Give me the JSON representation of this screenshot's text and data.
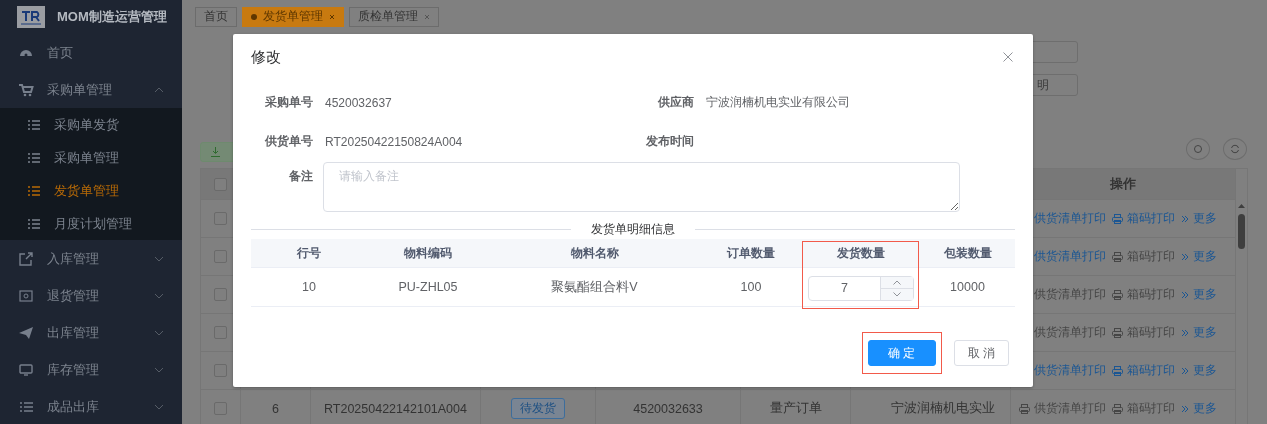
{
  "sidebar": {
    "title": "MOM制造运营管理",
    "items": [
      {
        "label": "首页"
      },
      {
        "label": "采购单管理",
        "expanded": true,
        "children": [
          {
            "label": "采购单发货",
            "selected": false
          },
          {
            "label": "采购单管理",
            "selected": false
          },
          {
            "label": "发货单管理",
            "selected": true
          },
          {
            "label": "月度计划管理",
            "selected": false
          }
        ]
      },
      {
        "label": "入库管理",
        "expanded": false
      },
      {
        "label": "退货管理",
        "expanded": false
      },
      {
        "label": "出库管理",
        "expanded": false
      },
      {
        "label": "库存管理",
        "expanded": false
      },
      {
        "label": "成品出库",
        "expanded": false
      }
    ]
  },
  "tabs": [
    {
      "label": "首页",
      "selected": false,
      "closable": false
    },
    {
      "label": "发货单管理",
      "selected": true,
      "closable": true
    },
    {
      "label": "质检单管理",
      "selected": false,
      "closable": true
    }
  ],
  "filter_field_placeholder": "明",
  "table": {
    "header_checked": false,
    "action_header": "操作",
    "rows": [
      {
        "checked": false,
        "actions": [
          {
            "label": "供货清单打印",
            "disabled": false
          },
          {
            "label": "箱码打印",
            "disabled": false
          },
          {
            "label": "更多",
            "disabled": false
          }
        ]
      },
      {
        "checked": false,
        "actions": [
          {
            "label": "供货清单打印",
            "disabled": false
          },
          {
            "label": "箱码打印",
            "disabled": true
          },
          {
            "label": "更多",
            "disabled": false
          }
        ]
      },
      {
        "checked": false,
        "actions": [
          {
            "label": "供货清单打印",
            "disabled": true
          },
          {
            "label": "箱码打印",
            "disabled": true
          },
          {
            "label": "更多",
            "disabled": false
          }
        ]
      },
      {
        "checked": false,
        "actions": [
          {
            "label": "供货清单打印",
            "disabled": true
          },
          {
            "label": "箱码打印",
            "disabled": true
          },
          {
            "label": "更多",
            "disabled": false
          }
        ]
      },
      {
        "checked": false,
        "actions": [
          {
            "label": "供货清单打印",
            "disabled": false
          },
          {
            "label": "箱码打印",
            "disabled": false
          },
          {
            "label": "更多",
            "disabled": false
          }
        ]
      },
      {
        "checked": false,
        "index": "6",
        "supply_no": "RT20250422142101A004",
        "status": "待发货",
        "purchase_no": "4520032633",
        "order_type": "量产订单",
        "supplier": "宁波润楠机电实业",
        "actions": [
          {
            "label": "供货清单打印",
            "disabled": true
          },
          {
            "label": "箱码打印",
            "disabled": true
          },
          {
            "label": "更多",
            "disabled": false
          }
        ]
      }
    ]
  },
  "dialog": {
    "title": "修改",
    "fields": [
      {
        "label": "采购单号",
        "value": "4520032637"
      },
      {
        "label": "供应商",
        "value": "宁波润楠机电实业有限公司"
      },
      {
        "label": "供货单号",
        "value": "RT20250422150824A004"
      },
      {
        "label": "发布时间"
      }
    ],
    "remark": {
      "label": "备注",
      "placeholder": "请输入备注"
    },
    "section_title": "发货单明细信息",
    "columns": [
      {
        "label": "行号",
        "kind": "text",
        "highlighted": false
      },
      {
        "label": "物料编码",
        "kind": "text",
        "highlighted": false
      },
      {
        "label": "物料名称",
        "kind": "text",
        "highlighted": false
      },
      {
        "label": "订单数量",
        "kind": "text",
        "highlighted": false
      },
      {
        "label": "发货数量",
        "kind": "number",
        "highlighted": true
      },
      {
        "label": "包装数量",
        "kind": "text",
        "highlighted": false
      }
    ],
    "rows": [
      {
        "cells": [
          "10",
          "PU-ZHL05",
          "聚氨酯组合料V",
          "100",
          "7",
          "10000"
        ]
      }
    ],
    "buttons": [
      {
        "label": "确 定",
        "kind": "primary",
        "highlighted": true
      },
      {
        "label": "取 消",
        "kind": "default",
        "highlighted": false
      }
    ]
  }
}
